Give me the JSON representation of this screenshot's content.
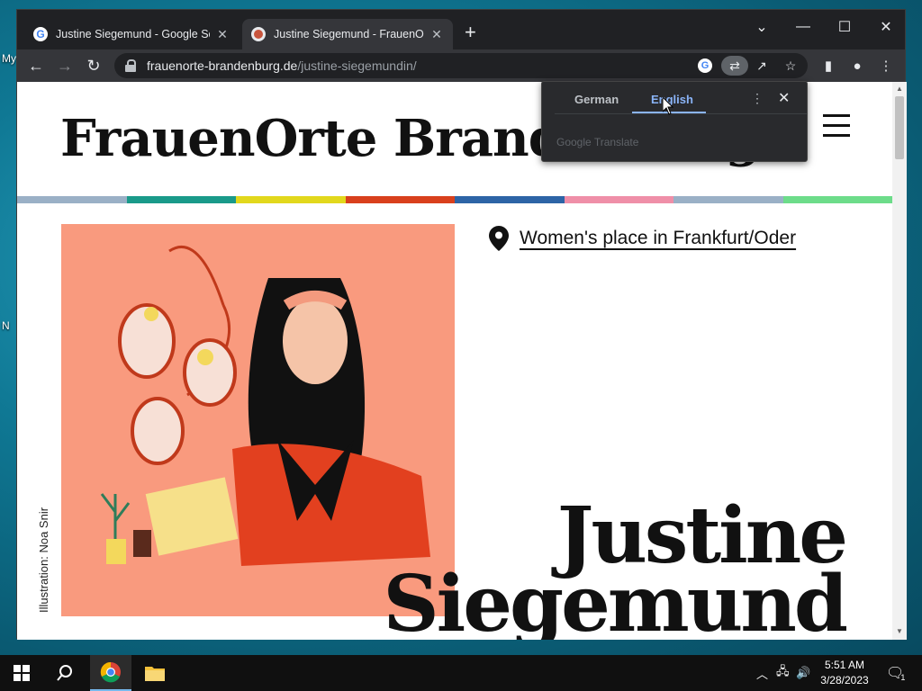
{
  "desktop": {
    "labels": [
      "My",
      "",
      "",
      "",
      "N"
    ]
  },
  "browser": {
    "tabs": [
      {
        "title": "Justine Siegemund - Google Sear",
        "favicon": "google-favicon",
        "active": false
      },
      {
        "title": "Justine Siegemund - FrauenOrte",
        "favicon": "frauenorte-favicon",
        "active": true
      }
    ],
    "new_tab": "+",
    "url_domain": "frauenorte-brandenburg.de",
    "url_path": "/justine-siegemundin/"
  },
  "translate": {
    "from": "German",
    "to": "English",
    "brand": "Google Translate"
  },
  "page": {
    "site_title": "FrauenOrte Brandenburg",
    "stripe_colors": [
      "#9ab0c6",
      "#1a9a8a",
      "#e2d81c",
      "#d9401c",
      "#2d64a6",
      "#ef8fa8",
      "#9ab0c6",
      "#6ddc8a"
    ],
    "illustration_credit": "Illustration: Noa Snir",
    "place_link": "Women's place in Frankfurt/Oder",
    "name_line1": "Justine",
    "name_line2": "Siegemund"
  },
  "taskbar": {
    "time": "5:51 AM",
    "date": "3/28/2023",
    "notification_count": "1"
  }
}
